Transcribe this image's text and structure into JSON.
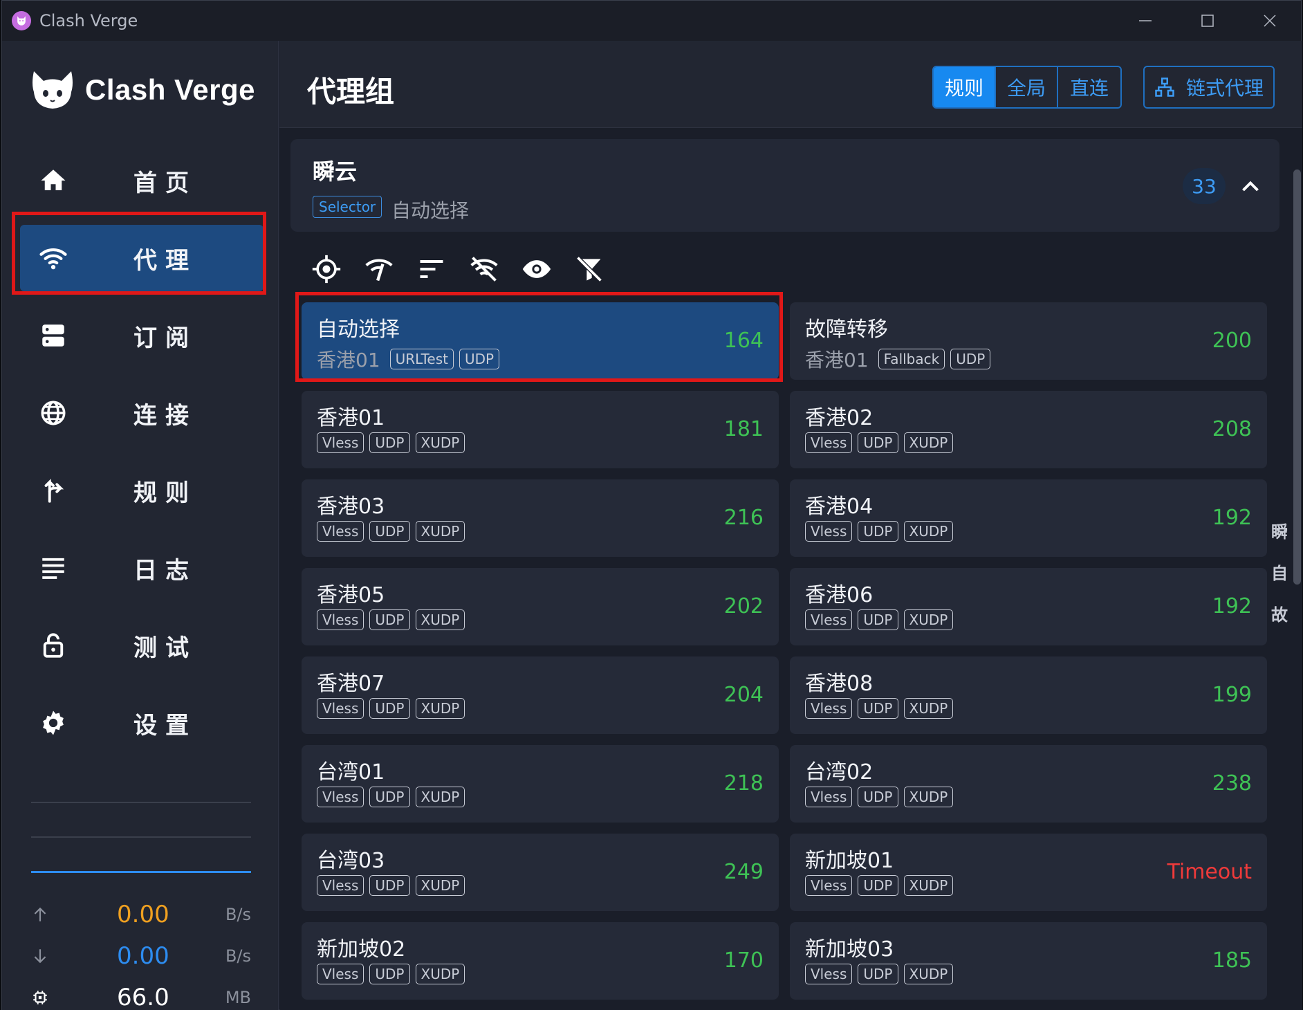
{
  "window": {
    "title": "Clash Verge",
    "controls": [
      "minimize",
      "maximize",
      "close"
    ]
  },
  "sidebar": {
    "brand": "Clash Verge",
    "items": [
      {
        "label": "首页",
        "icon": "home-icon",
        "active": false
      },
      {
        "label": "代理",
        "icon": "wifi-icon",
        "active": true
      },
      {
        "label": "订阅",
        "icon": "server-icon",
        "active": false
      },
      {
        "label": "连接",
        "icon": "globe-icon",
        "active": false
      },
      {
        "label": "规则",
        "icon": "fork-icon",
        "active": false
      },
      {
        "label": "日志",
        "icon": "list-icon",
        "active": false
      },
      {
        "label": "测试",
        "icon": "lock-icon",
        "active": false
      },
      {
        "label": "设置",
        "icon": "gear-icon",
        "active": false
      }
    ],
    "stats": {
      "upload": {
        "value": "0.00",
        "unit": "B/s",
        "color": "#f0a020"
      },
      "download": {
        "value": "0.00",
        "unit": "B/s",
        "color": "#2d8cf0"
      },
      "memory": {
        "value": "66.0",
        "unit": "MB",
        "color": "#ffffff"
      }
    }
  },
  "header": {
    "title": "代理组",
    "modes": [
      {
        "label": "规则",
        "active": true
      },
      {
        "label": "全局",
        "active": false
      },
      {
        "label": "直连",
        "active": false
      }
    ],
    "chain_label": "链式代理"
  },
  "group": {
    "name": "瞬云",
    "type": "Selector",
    "now": "自动选择",
    "count": "33"
  },
  "toolbar": [
    "locate-icon",
    "delay-test-icon",
    "sort-icon",
    "url-test-icon",
    "visibility-icon",
    "filter-off-icon"
  ],
  "proxies": [
    {
      "name": "自动选择",
      "now": "香港01",
      "tags": [
        "URLTest",
        "UDP"
      ],
      "delay": "164",
      "selected": true
    },
    {
      "name": "故障转移",
      "now": "香港01",
      "tags": [
        "Fallback",
        "UDP"
      ],
      "delay": "200"
    },
    {
      "name": "香港01",
      "tags": [
        "Vless",
        "UDP",
        "XUDP"
      ],
      "delay": "181"
    },
    {
      "name": "香港02",
      "tags": [
        "Vless",
        "UDP",
        "XUDP"
      ],
      "delay": "208"
    },
    {
      "name": "香港03",
      "tags": [
        "Vless",
        "UDP",
        "XUDP"
      ],
      "delay": "216"
    },
    {
      "name": "香港04",
      "tags": [
        "Vless",
        "UDP",
        "XUDP"
      ],
      "delay": "192"
    },
    {
      "name": "香港05",
      "tags": [
        "Vless",
        "UDP",
        "XUDP"
      ],
      "delay": "202"
    },
    {
      "name": "香港06",
      "tags": [
        "Vless",
        "UDP",
        "XUDP"
      ],
      "delay": "192"
    },
    {
      "name": "香港07",
      "tags": [
        "Vless",
        "UDP",
        "XUDP"
      ],
      "delay": "204"
    },
    {
      "name": "香港08",
      "tags": [
        "Vless",
        "UDP",
        "XUDP"
      ],
      "delay": "199"
    },
    {
      "name": "台湾01",
      "tags": [
        "Vless",
        "UDP",
        "XUDP"
      ],
      "delay": "218"
    },
    {
      "name": "台湾02",
      "tags": [
        "Vless",
        "UDP",
        "XUDP"
      ],
      "delay": "238"
    },
    {
      "name": "台湾03",
      "tags": [
        "Vless",
        "UDP",
        "XUDP"
      ],
      "delay": "249"
    },
    {
      "name": "新加坡01",
      "tags": [
        "Vless",
        "UDP",
        "XUDP"
      ],
      "delay": "Timeout",
      "timeout": true
    },
    {
      "name": "新加坡02",
      "tags": [
        "Vless",
        "UDP",
        "XUDP"
      ],
      "delay": "170"
    },
    {
      "name": "新加坡03",
      "tags": [
        "Vless",
        "UDP",
        "XUDP"
      ],
      "delay": "185"
    }
  ],
  "side_index": [
    "瞬",
    "自",
    "故"
  ],
  "colors": {
    "accent": "#1789f0",
    "active_bg": "#1d4a80",
    "delay_ok": "#3ec255",
    "delay_timeout": "#ef3a3a",
    "highlight_box": "#e01818"
  }
}
